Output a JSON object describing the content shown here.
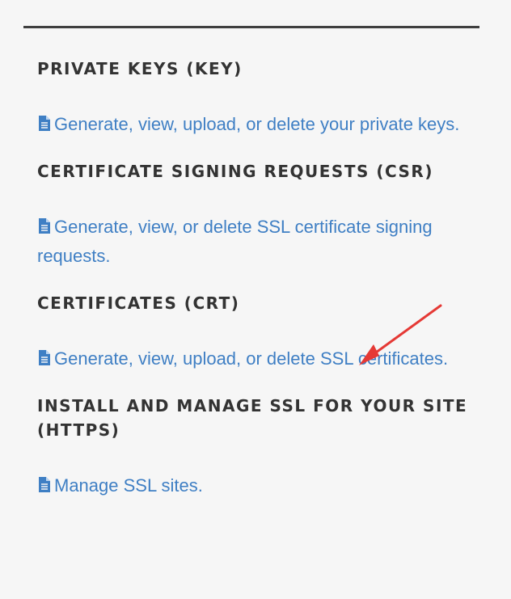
{
  "sections": [
    {
      "heading": "PRIVATE KEYS (KEY)",
      "link": "Generate, view, upload, or delete your private keys."
    },
    {
      "heading": "CERTIFICATE SIGNING REQUESTS (CSR)",
      "link": "Generate, view, or delete SSL certificate signing requests."
    },
    {
      "heading": "CERTIFICATES (CRT)",
      "link": "Generate, view, upload, or delete SSL certificates."
    },
    {
      "heading": "INSTALL AND MANAGE SSL FOR YOUR SITE (HTTPS)",
      "link": "Manage SSL sites."
    }
  ],
  "icons": {
    "link_icon": "document-icon",
    "annotation": "red-arrow-icon"
  },
  "colors": {
    "heading": "#333333",
    "link": "#3f7fc4",
    "arrow": "#e53935"
  }
}
